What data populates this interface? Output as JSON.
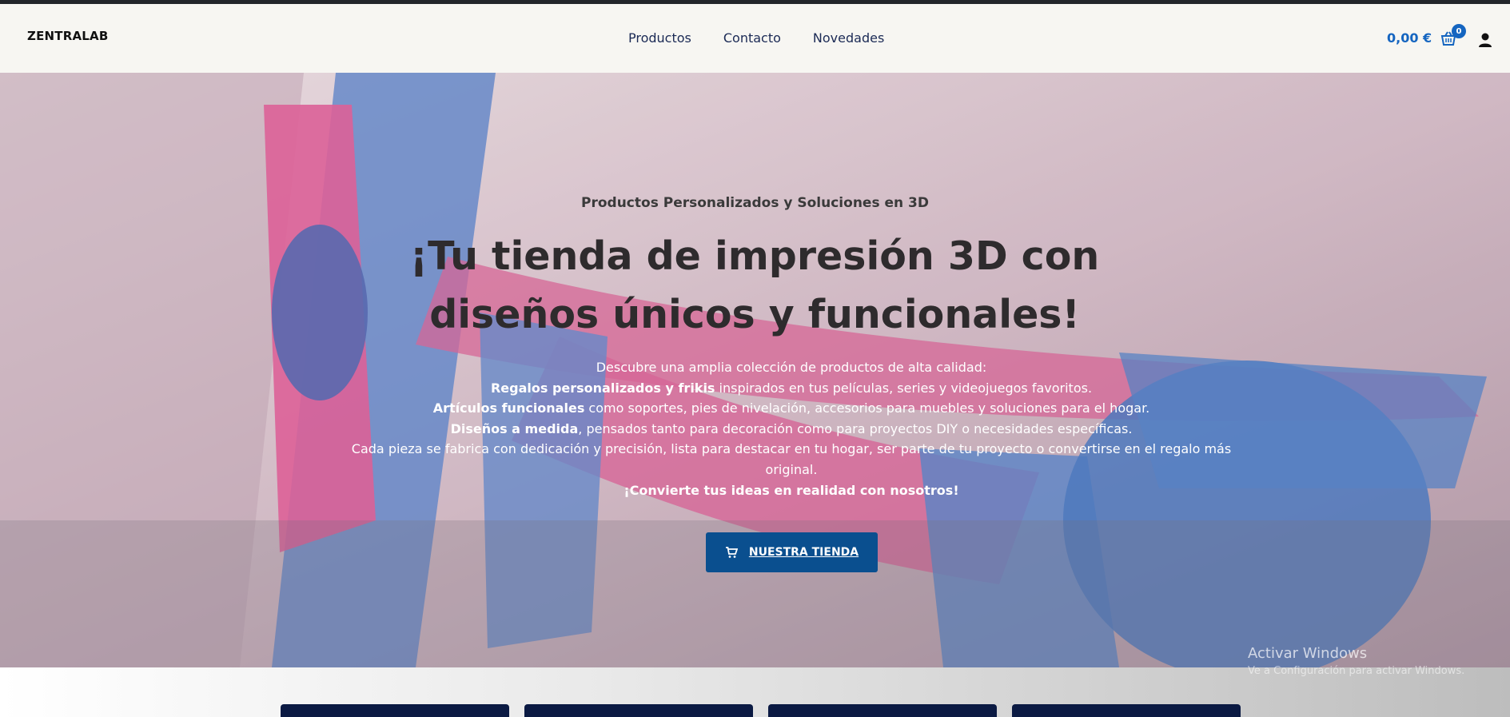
{
  "header": {
    "brand": "ZENTRALAB",
    "nav": [
      "Productos",
      "Contacto",
      "Novedades"
    ],
    "cart_total": "0,00 €",
    "cart_count": "0"
  },
  "hero": {
    "subtitle": "Productos Personalizados y Soluciones en 3D",
    "headline": "¡Tu tienda de impresión 3D con diseños únicos y funcionales!",
    "intro": "Descubre una amplia colección de productos de alta calidad:",
    "line1_bold": "Regalos personalizados y frikis",
    "line1_rest": " inspirados en tus películas, series y videojuegos favoritos.",
    "line2_bold": "Artículos funcionales",
    "line2_rest": " como soportes, pies de nivelación, accesorios para muebles y soluciones para el hogar.",
    "line3_bold": "Diseños a medida",
    "line3_rest": ", pensados tanto para decoración como para proyectos DIY o necesidades específicas.",
    "line4": "Cada pieza se fabrica con dedicación y precisión, lista para destacar en tu hogar, ser parte de tu proyecto o convertirse en el regalo más original.",
    "closing": "¡Convierte tus ideas en realidad con nosotros!",
    "cta_label": "NUESTRA TIENDA"
  },
  "watermark": {
    "title": "Activar Windows",
    "subtitle": "Ve a Configuración para activar Windows."
  },
  "colors": {
    "accent": "#1565c0",
    "cta": "#0a4f8f",
    "navy": "#0b1a43"
  },
  "icons": {
    "cart": "basket-icon",
    "user": "user-icon",
    "cta": "cart-icon"
  }
}
